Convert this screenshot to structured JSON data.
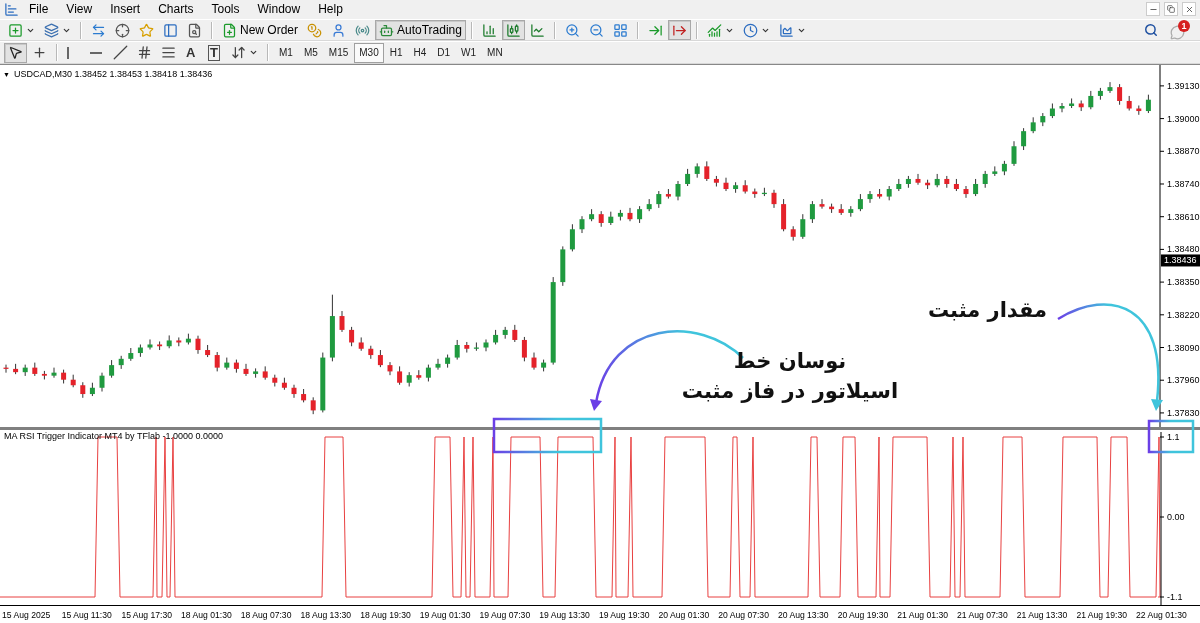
{
  "menu_bar": {
    "items": [
      "File",
      "View",
      "Insert",
      "Charts",
      "Tools",
      "Window",
      "Help"
    ]
  },
  "notifications": {
    "badge": "1"
  },
  "toolbar": {
    "items": [
      {
        "kind": "icon",
        "pressed": false
      },
      {
        "kind": "icon",
        "pressed": false
      },
      {
        "kind": "separator"
      },
      {
        "kind": "icon",
        "pressed": false
      },
      {
        "kind": "icon",
        "pressed": false
      },
      {
        "kind": "icon",
        "pressed": false
      },
      {
        "kind": "icon",
        "pressed": false
      },
      {
        "kind": "icon",
        "pressed": false
      },
      {
        "kind": "separator"
      },
      {
        "kind": "button",
        "label": "New Order",
        "pressed": false
      },
      {
        "kind": "icon",
        "pressed": false
      },
      {
        "kind": "icon",
        "pressed": false
      },
      {
        "kind": "icon",
        "pressed": false
      },
      {
        "kind": "button",
        "label": "AutoTrading",
        "pressed": true
      },
      {
        "kind": "separator"
      },
      {
        "kind": "icon",
        "pressed": false
      },
      {
        "kind": "icon",
        "pressed": true
      },
      {
        "kind": "icon",
        "pressed": false
      },
      {
        "kind": "separator"
      },
      {
        "kind": "icon",
        "pressed": false
      },
      {
        "kind": "icon",
        "pressed": false
      },
      {
        "kind": "icon",
        "pressed": false
      },
      {
        "kind": "separator"
      },
      {
        "kind": "icon",
        "pressed": false
      },
      {
        "kind": "icon",
        "pressed": true
      },
      {
        "kind": "separator"
      },
      {
        "kind": "icon",
        "pressed": false
      },
      {
        "kind": "icon",
        "pressed": false
      },
      {
        "kind": "icon",
        "pressed": false
      }
    ]
  },
  "drawing_toolbar": {
    "tools": [
      {
        "kind": "icon",
        "pressed": true
      },
      {
        "kind": "icon",
        "pressed": false
      },
      {
        "kind": "separator"
      },
      {
        "kind": "icon",
        "pressed": false
      },
      {
        "kind": "icon",
        "pressed": false
      },
      {
        "kind": "icon",
        "pressed": false
      },
      {
        "kind": "icon",
        "pressed": false
      },
      {
        "kind": "icon",
        "pressed": false
      },
      {
        "kind": "glyph",
        "label": "A",
        "pressed": false
      },
      {
        "kind": "boxed_glyph",
        "label": "T",
        "pressed": false
      },
      {
        "kind": "icon",
        "pressed": false
      },
      {
        "kind": "separator"
      }
    ],
    "timeframes": [
      {
        "label": "M1",
        "selected": false
      },
      {
        "label": "M5",
        "selected": false
      },
      {
        "label": "M15",
        "selected": false
      },
      {
        "label": "M30",
        "selected": true
      },
      {
        "label": "H1",
        "selected": false
      },
      {
        "label": "H4",
        "selected": false
      },
      {
        "label": "D1",
        "selected": false
      },
      {
        "label": "W1",
        "selected": false
      },
      {
        "label": "MN",
        "selected": false
      }
    ]
  },
  "chart": {
    "header": {
      "marker": "▼",
      "symbol": "USDCAD,M30",
      "quotes": "1.38452 1.38453 1.38418 1.38436"
    },
    "chart_data": {
      "type": "candlestick",
      "ylim": [
        1.37774,
        1.39213
      ],
      "yticks": [
        {
          "value": 1.3913,
          "label": "1.39130"
        },
        {
          "value": 1.39,
          "label": "1.39000"
        },
        {
          "value": 1.3887,
          "label": "1.38870"
        },
        {
          "value": 1.3874,
          "label": "1.38740"
        },
        {
          "value": 1.3861,
          "label": "1.38610"
        },
        {
          "value": 1.3848,
          "label": "1.38480"
        },
        {
          "value": 1.3835,
          "label": "1.38350"
        },
        {
          "value": 1.3822,
          "label": "1.38220"
        },
        {
          "value": 1.3809,
          "label": "1.38090"
        },
        {
          "value": 1.3796,
          "label": "1.37960"
        },
        {
          "value": 1.3783,
          "label": "1.37830"
        }
      ],
      "ohlc": [
        [
          1.3801,
          1.38022,
          1.3799,
          1.38005
        ],
        [
          1.38005,
          1.38025,
          1.37984,
          1.37992
        ],
        [
          1.37992,
          1.38022,
          1.37977,
          1.3801
        ],
        [
          1.3801,
          1.3803,
          1.37977,
          1.37985
        ],
        [
          1.37985,
          1.37997,
          1.37963,
          1.37978
        ],
        [
          1.37978,
          1.3801,
          1.3797,
          1.3799
        ],
        [
          1.3799,
          1.38002,
          1.37947,
          1.37962
        ],
        [
          1.37962,
          1.37982,
          1.37932,
          1.3794
        ],
        [
          1.3794,
          1.37952,
          1.3789,
          1.37905
        ],
        [
          1.37905,
          1.3795,
          1.37897,
          1.3793
        ],
        [
          1.3793,
          1.3799,
          1.37915,
          1.37978
        ],
        [
          1.37978,
          1.3804,
          1.3797,
          1.3802
        ],
        [
          1.3802,
          1.38057,
          1.38005,
          1.38045
        ],
        [
          1.38045,
          1.38088,
          1.38037,
          1.38068
        ],
        [
          1.38068,
          1.38102,
          1.38053,
          1.3809
        ],
        [
          1.3809,
          1.38122,
          1.38082,
          1.38102
        ],
        [
          1.38102,
          1.38114,
          1.3808,
          1.38095
        ],
        [
          1.38095,
          1.38138,
          1.38087,
          1.38118
        ],
        [
          1.38118,
          1.3813,
          1.38095,
          1.3811
        ],
        [
          1.3811,
          1.38145,
          1.38102,
          1.38125
        ],
        [
          1.38125,
          1.38137,
          1.38065,
          1.3808
        ],
        [
          1.3808,
          1.381,
          1.38052,
          1.3806
        ],
        [
          1.3806,
          1.38072,
          1.37995,
          1.3801
        ],
        [
          1.3801,
          1.3805,
          1.38002,
          1.3803
        ],
        [
          1.3803,
          1.38042,
          1.3799,
          1.38005
        ],
        [
          1.38005,
          1.38025,
          1.37977,
          1.37985
        ],
        [
          1.37985,
          1.38007,
          1.3797,
          1.37995
        ],
        [
          1.37995,
          1.38015,
          1.37962,
          1.3797
        ],
        [
          1.3797,
          1.37982,
          1.37935,
          1.3795
        ],
        [
          1.3795,
          1.3797,
          1.37922,
          1.3793
        ],
        [
          1.3793,
          1.37942,
          1.3789,
          1.37905
        ],
        [
          1.37905,
          1.37925,
          1.37872,
          1.3788
        ],
        [
          1.3788,
          1.37892,
          1.37825,
          1.3784
        ],
        [
          1.3784,
          1.3807,
          1.37832,
          1.3805
        ],
        [
          1.3805,
          1.383,
          1.38035,
          1.38215
        ],
        [
          1.38215,
          1.38235,
          1.38152,
          1.3816
        ],
        [
          1.3816,
          1.38172,
          1.38095,
          1.3811
        ],
        [
          1.3811,
          1.3813,
          1.38077,
          1.38085
        ],
        [
          1.38085,
          1.38097,
          1.38045,
          1.3806
        ],
        [
          1.3806,
          1.3808,
          1.38012,
          1.3802
        ],
        [
          1.3802,
          1.38032,
          1.3798,
          1.37995
        ],
        [
          1.37995,
          1.38015,
          1.37942,
          1.3795
        ],
        [
          1.3795,
          1.37992,
          1.37935,
          1.3798
        ],
        [
          1.3798,
          1.38,
          1.37962,
          1.3797
        ],
        [
          1.3797,
          1.38022,
          1.37955,
          1.3801
        ],
        [
          1.3801,
          1.38045,
          1.38002,
          1.38025
        ],
        [
          1.38025,
          1.38062,
          1.3801,
          1.3805
        ],
        [
          1.3805,
          1.3812,
          1.38042,
          1.381
        ],
        [
          1.381,
          1.38112,
          1.3807,
          1.38085
        ],
        [
          1.38085,
          1.3811,
          1.38077,
          1.3809
        ],
        [
          1.3809,
          1.38122,
          1.38075,
          1.3811
        ],
        [
          1.3811,
          1.3816,
          1.38102,
          1.3814
        ],
        [
          1.3814,
          1.38172,
          1.38125,
          1.3816
        ],
        [
          1.3816,
          1.3818,
          1.38112,
          1.3812
        ],
        [
          1.3812,
          1.38132,
          1.38035,
          1.3805
        ],
        [
          1.3805,
          1.3807,
          1.38002,
          1.3801
        ],
        [
          1.3801,
          1.38042,
          1.37995,
          1.3803
        ],
        [
          1.3803,
          1.3837,
          1.38022,
          1.3835
        ],
        [
          1.3835,
          1.38492,
          1.38335,
          1.3848
        ],
        [
          1.3848,
          1.3858,
          1.38472,
          1.3856
        ],
        [
          1.3856,
          1.38612,
          1.38545,
          1.386
        ],
        [
          1.386,
          1.3864,
          1.38592,
          1.3862
        ],
        [
          1.3862,
          1.38632,
          1.3857,
          1.38585
        ],
        [
          1.38585,
          1.3863,
          1.38577,
          1.3861
        ],
        [
          1.3861,
          1.38637,
          1.38595,
          1.38625
        ],
        [
          1.38625,
          1.38645,
          1.38592,
          1.386
        ],
        [
          1.386,
          1.38652,
          1.38585,
          1.3864
        ],
        [
          1.3864,
          1.3868,
          1.38632,
          1.3866
        ],
        [
          1.3866,
          1.38712,
          1.38645,
          1.387
        ],
        [
          1.387,
          1.3872,
          1.38682,
          1.3869
        ],
        [
          1.3869,
          1.38752,
          1.38675,
          1.3874
        ],
        [
          1.3874,
          1.388,
          1.38732,
          1.3878
        ],
        [
          1.3878,
          1.38822,
          1.38765,
          1.3881
        ],
        [
          1.3881,
          1.3883,
          1.38752,
          1.3876
        ],
        [
          1.3876,
          1.38772,
          1.3873,
          1.38745
        ],
        [
          1.38745,
          1.38765,
          1.38712,
          1.3872
        ],
        [
          1.3872,
          1.38747,
          1.38705,
          1.38735
        ],
        [
          1.38735,
          1.38755,
          1.38702,
          1.3871
        ],
        [
          1.3871,
          1.38722,
          1.38685,
          1.387
        ],
        [
          1.387,
          1.38725,
          1.38692,
          1.38705
        ],
        [
          1.38705,
          1.38717,
          1.38645,
          1.3866
        ],
        [
          1.3866,
          1.3868,
          1.38552,
          1.3856
        ],
        [
          1.3856,
          1.38572,
          1.38515,
          1.3853
        ],
        [
          1.3853,
          1.3862,
          1.38522,
          1.386
        ],
        [
          1.386,
          1.38672,
          1.38585,
          1.3866
        ],
        [
          1.3866,
          1.3868,
          1.38642,
          1.3865
        ],
        [
          1.3865,
          1.38662,
          1.38625,
          1.3864
        ],
        [
          1.3864,
          1.3866,
          1.38617,
          1.38625
        ],
        [
          1.38625,
          1.38652,
          1.3861,
          1.3864
        ],
        [
          1.3864,
          1.387,
          1.38632,
          1.3868
        ],
        [
          1.3868,
          1.38712,
          1.38665,
          1.387
        ],
        [
          1.387,
          1.3872,
          1.38682,
          1.3869
        ],
        [
          1.3869,
          1.38732,
          1.38675,
          1.3872
        ],
        [
          1.3872,
          1.3876,
          1.38712,
          1.3874
        ],
        [
          1.3874,
          1.38772,
          1.38725,
          1.3876
        ],
        [
          1.3876,
          1.3878,
          1.38737,
          1.38745
        ],
        [
          1.38745,
          1.38757,
          1.3872,
          1.38735
        ],
        [
          1.38735,
          1.3878,
          1.38727,
          1.3876
        ],
        [
          1.3876,
          1.38772,
          1.38725,
          1.3874
        ],
        [
          1.3874,
          1.3876,
          1.38712,
          1.3872
        ],
        [
          1.3872,
          1.38732,
          1.38685,
          1.387
        ],
        [
          1.387,
          1.3876,
          1.38692,
          1.3874
        ],
        [
          1.3874,
          1.38792,
          1.38725,
          1.3878
        ],
        [
          1.3878,
          1.3881,
          1.38772,
          1.3879
        ],
        [
          1.3879,
          1.38832,
          1.38775,
          1.3882
        ],
        [
          1.3882,
          1.3891,
          1.38812,
          1.3889
        ],
        [
          1.3889,
          1.38962,
          1.38875,
          1.3895
        ],
        [
          1.3895,
          1.39005,
          1.38942,
          1.38985
        ],
        [
          1.38985,
          1.39022,
          1.3897,
          1.3901
        ],
        [
          1.3901,
          1.3906,
          1.39002,
          1.3904
        ],
        [
          1.3904,
          1.39062,
          1.39025,
          1.3905
        ],
        [
          1.3905,
          1.3908,
          1.39042,
          1.3906
        ],
        [
          1.3906,
          1.39072,
          1.3903,
          1.39045
        ],
        [
          1.39045,
          1.3911,
          1.39037,
          1.3909
        ],
        [
          1.3909,
          1.39122,
          1.39075,
          1.3911
        ],
        [
          1.3911,
          1.39145,
          1.39102,
          1.39125
        ],
        [
          1.39125,
          1.39137,
          1.39055,
          1.3907
        ],
        [
          1.3907,
          1.3909,
          1.39032,
          1.3904
        ],
        [
          1.3904,
          1.39052,
          1.39015,
          1.3903
        ],
        [
          1.3903,
          1.39095,
          1.39022,
          1.39075
        ]
      ]
    },
    "current_price": "1.38436",
    "indicator": {
      "title": "MA RSI Trigger Indicator MT4 by TFlab -1.0000 0.0000",
      "axis": [
        "1.1",
        "0.00",
        "-1.1"
      ]
    },
    "time_axis": [
      "15 Aug 2025",
      "15 Aug 11:30",
      "15 Aug 17:30",
      "18 Aug 01:30",
      "18 Aug 07:30",
      "18 Aug 13:30",
      "18 Aug 19:30",
      "19 Aug 01:30",
      "19 Aug 07:30",
      "19 Aug 13:30",
      "19 Aug 19:30",
      "20 Aug 01:30",
      "20 Aug 07:30",
      "20 Aug 13:30",
      "20 Aug 19:30",
      "21 Aug 01:30",
      "21 Aug 07:30",
      "21 Aug 13:30",
      "21 Aug 19:30",
      "22 Aug 01:30"
    ]
  },
  "annotations": [
    {
      "lines": [
        "نوسان خط",
        "اسیلاتور در فاز مثبت"
      ]
    },
    {
      "lines": [
        "مقدار مثبت"
      ]
    }
  ]
}
